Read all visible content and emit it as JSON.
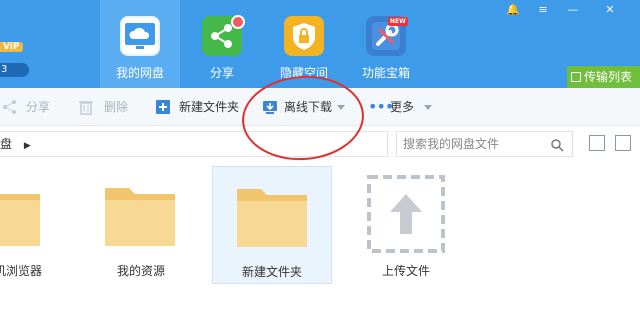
{
  "header": {
    "vip_label": "ViP",
    "level": "3",
    "nav": [
      {
        "label": "我的网盘",
        "icon": "cloud-disk-icon"
      },
      {
        "label": "分享",
        "icon": "share-icon"
      },
      {
        "label": "隐藏空间",
        "icon": "lock-icon"
      },
      {
        "label": "功能宝箱",
        "icon": "toolbox-icon"
      }
    ],
    "new_badge": "NEW",
    "window_controls": {
      "notify": "🔔",
      "menu": "≡",
      "minimize": "—",
      "close": "✕"
    },
    "transfer_label": "传输列表"
  },
  "toolbar": {
    "share_label": "分享",
    "delete_label": "删除",
    "new_folder_label": "新建文件夹",
    "offline_download_label": "离线下载",
    "more_label": "更多"
  },
  "pathbar": {
    "crumb": "盘",
    "search_placeholder": "搜索我的网盘文件"
  },
  "files": [
    {
      "name": "度手机浏览器",
      "type": "folder"
    },
    {
      "name": "我的资源",
      "type": "folder"
    },
    {
      "name": "新建文件夹",
      "type": "folder",
      "selected": true
    },
    {
      "name": "上传文件",
      "type": "upload"
    }
  ],
  "colors": {
    "header_blue": "#3e9bea",
    "accent_green": "#6fbe3c",
    "folder_yellow": "#f6d58c",
    "annotation_red": "#e0302c"
  }
}
